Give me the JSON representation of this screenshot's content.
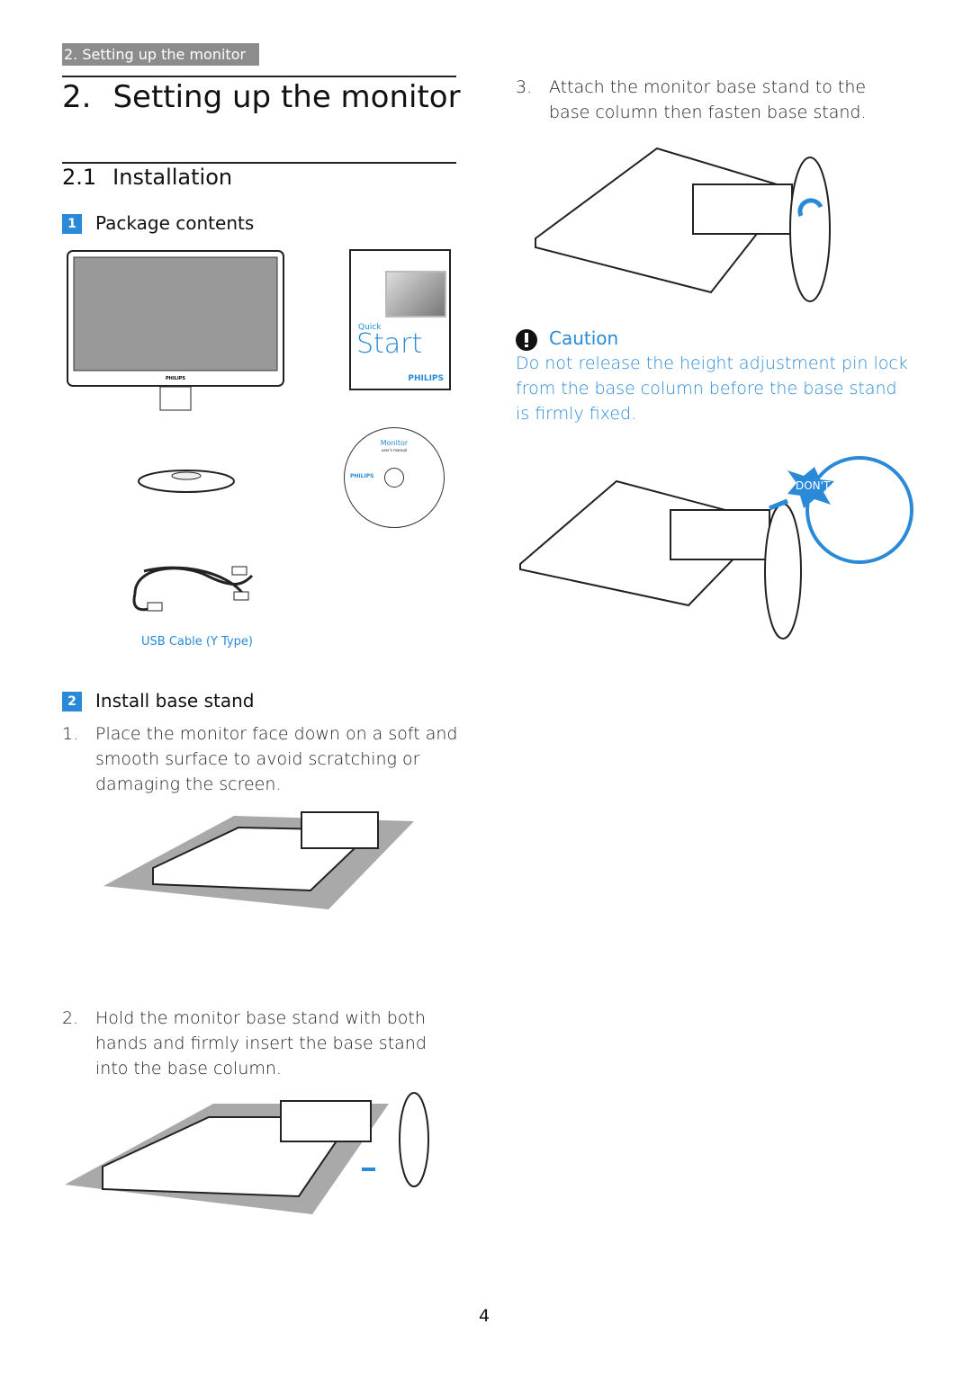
{
  "header_tag": "2. Setting up the monitor",
  "title": {
    "number": "2.",
    "text": "Setting up the monitor"
  },
  "section": {
    "number": "2.1",
    "text": "Installation"
  },
  "package": {
    "badge": "1",
    "heading": "Package contents",
    "quick_start": {
      "small": "Quick",
      "big": "Start",
      "brand": "PHILIPS"
    },
    "cd": {
      "title": "Monitor",
      "subtitle": "user's manual",
      "brand": "PHILIPS"
    },
    "usb_caption": "USB Cable (Y Type)",
    "monitor_brand": "PHILIPS"
  },
  "install": {
    "badge": "2",
    "heading": "Install base stand",
    "steps": [
      {
        "num": "1.",
        "text": "Place the monitor face down on a soft and smooth surface to avoid scratching or damaging the screen."
      },
      {
        "num": "2.",
        "text": "Hold the monitor base stand with both hands and firmly insert the base stand into the base column."
      },
      {
        "num": "3.",
        "text": "Attach the monitor base stand to the base column then fasten base stand."
      }
    ]
  },
  "caution": {
    "label": "Caution",
    "text": "Do not release the height adjustment pin lock from the base column before the base stand is firmly fixed.",
    "dont": "DON'T"
  },
  "brand_color": "#2a8ad8",
  "page_number": "4"
}
